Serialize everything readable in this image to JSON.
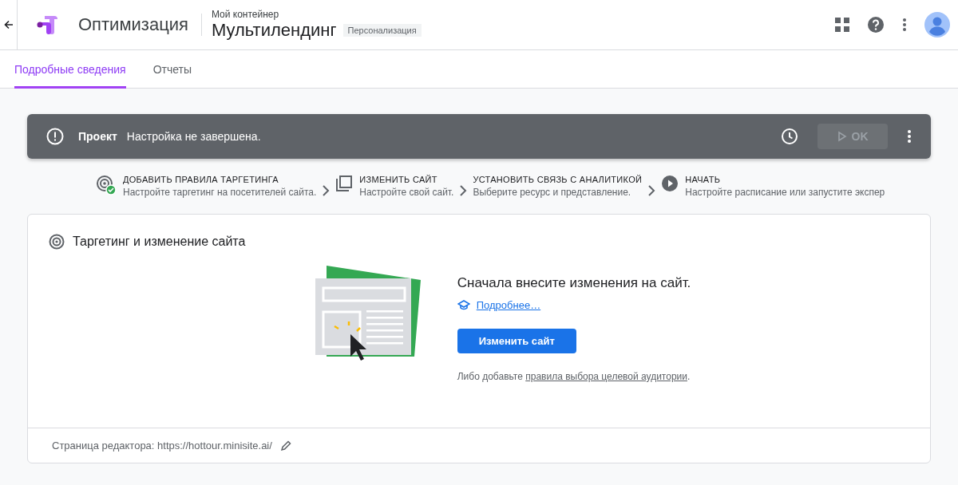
{
  "header": {
    "product": "Оптимизация",
    "container": "Мой контейнер",
    "experience": "Мультилендинг",
    "type_badge": "Персонализация"
  },
  "tabs": [
    {
      "label": "Подробные сведения",
      "selected": true
    },
    {
      "label": "Отчеты",
      "selected": false
    }
  ],
  "banner": {
    "title": "Проект",
    "message": "Настройка не завершена.",
    "start_button": {
      "label": "OK",
      "disabled": true
    }
  },
  "steps": [
    {
      "kind": "target",
      "done": true,
      "title": "ДОБАВИТЬ ПРАВИЛА ТАРГЕТИНГА",
      "description": "Настройте таргетинг на посетителей сайта."
    },
    {
      "kind": "edit",
      "title": "ИЗМЕНИТЬ САЙТ",
      "description": "Настройте свой сайт."
    },
    {
      "kind": "analytics",
      "title": "УСТАНОВИТЬ СВЯЗЬ С АНАЛИТИКОЙ",
      "description": "Выберите ресурс и представление."
    },
    {
      "kind": "start",
      "title": "НАЧАТЬ",
      "description": "Настройте расписание или запустите экспер"
    }
  ],
  "card": {
    "heading": "Таргетинг и изменение сайта",
    "message": "Сначала внесите изменения на сайт.",
    "learn_more": "Подробнее…",
    "button": "Изменить сайт",
    "note_prefix": "Либо добавьте ",
    "note_link": "правила выбора целевой аудитории",
    "note_suffix": ".",
    "editor_page": "Страница редактора: https://hottour.minisite.ai/"
  }
}
